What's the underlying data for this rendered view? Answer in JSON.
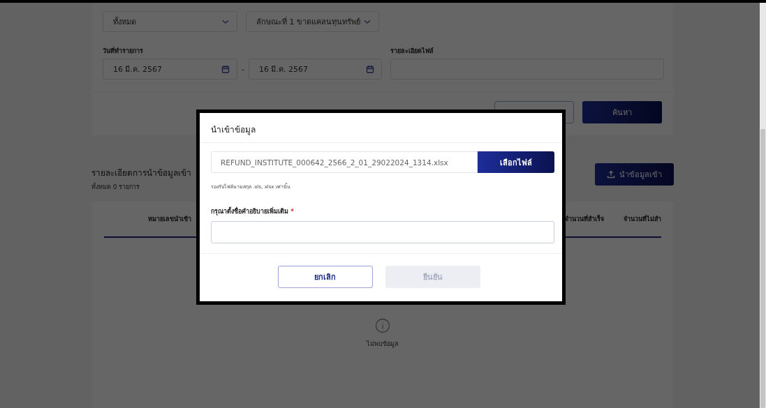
{
  "filters": {
    "selects": [
      {
        "value": "ทั้งหมด"
      },
      {
        "value": "ลักษณะที่ 1 ขาดแคลนทุนทรัพย์"
      }
    ],
    "date_label": "วันที่ทำรายการ",
    "date_from": "16 มี.ค. 2567",
    "date_separator": "-",
    "date_to": "16 มี.ค. 2567",
    "file_label": "รายละเอียดไฟล์",
    "buttons": [
      {
        "kind": "outline"
      },
      {
        "label": "ค้นหา",
        "kind": "primary"
      }
    ]
  },
  "section": {
    "title": "รายละเอียดการนำข้อมูลเข้า",
    "subtitle": "ทั้งหมด 0 รายการ",
    "import_button": "นำข้อมูลเข้า"
  },
  "table": {
    "columns": [
      "หมายเลขนำเข้า",
      "จำนวนที่สำเร็จ",
      "จำนวนที่ไม่สำ"
    ],
    "empty_text": "ไม่พบข้อมูล"
  },
  "dialog": {
    "title": "นำเข้าข้อมูล",
    "file_name": "REFUND_INSTITUTE_000642_2566_2_01_29022024_1314.xlsx",
    "choose_button": "เลือกไฟล์",
    "hint": "รองรับไฟล์นามสกุล .xls, xlsx เท่านั้น",
    "description_label": "กรุณาตั้งชื่อคำอธิบายเพิ่มเติม",
    "required_mark": "*",
    "buttons": [
      {
        "label": "ยกเลิก",
        "disabled": false
      },
      {
        "label": "ยืนยัน",
        "disabled": true
      }
    ]
  }
}
